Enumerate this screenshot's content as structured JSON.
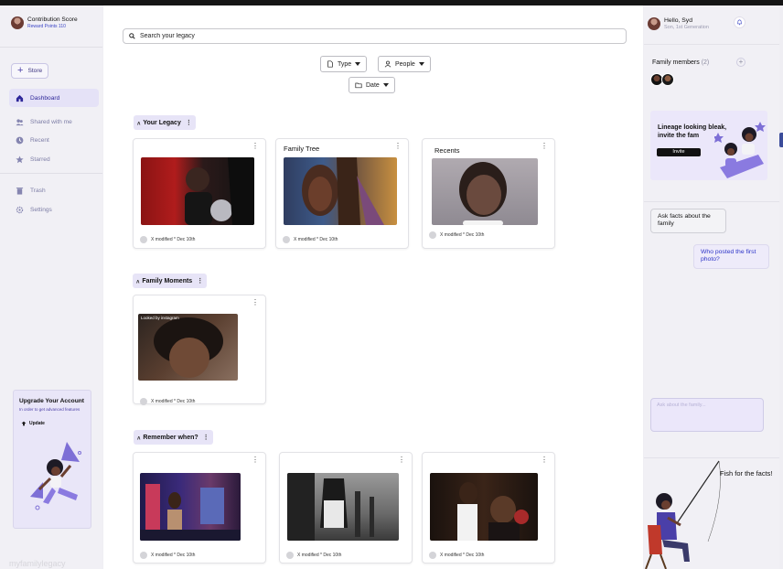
{
  "sidebar": {
    "profile": {
      "title": "Contribution Score",
      "subtitle": "Reward Points 110"
    },
    "store_label": "Store",
    "nav": [
      {
        "label": "Dashboard",
        "icon": "home-icon"
      },
      {
        "label": "Shared with me",
        "icon": "people-icon"
      },
      {
        "label": "Recent",
        "icon": "clock-icon"
      },
      {
        "label": "Starred",
        "icon": "star-icon"
      },
      {
        "label": "Trash",
        "icon": "trash-icon"
      },
      {
        "label": "Settings",
        "icon": "gear-icon"
      }
    ],
    "upgrade": {
      "title": "Upgrade Your Account",
      "subtitle": "In order to get advanced features",
      "button": "Update"
    }
  },
  "main": {
    "search_placeholder": "Search your legacy",
    "filters": {
      "type": "Type",
      "people": "People",
      "date": "Date"
    },
    "sections": [
      {
        "title": "Your Legacy",
        "cards": [
          {
            "title": "",
            "meta": "X modified * Dec 10th"
          },
          {
            "title": "Family Tree",
            "meta": "X modified * Dec 10th"
          },
          {
            "title": "Recents",
            "meta": "X modified * Dec 10th"
          }
        ]
      },
      {
        "title": "Family Moments",
        "cards": [
          {
            "title": "",
            "meta": "X modified * Dec 10th",
            "overlay": "Looked by instagram"
          }
        ]
      },
      {
        "title": "Remember when?",
        "cards": [
          {
            "title": "",
            "meta": "X modified * Dec 10th"
          },
          {
            "title": "",
            "meta": "X modified * Dec 10th"
          },
          {
            "title": "",
            "meta": "X modified * Dec 10th"
          }
        ]
      }
    ]
  },
  "right": {
    "greeting": "Hello, Syd",
    "generation": "Son, 1st Generation",
    "family_members_label": "Family members",
    "family_members_count": "(2)",
    "invite_title": "Lineage looking bleak, invite the fam",
    "invite_button": "Invite",
    "chip_answer": "Ask facts about the family",
    "chip_question": "Who posted the first photo?",
    "ask_placeholder": "Ask about the family...",
    "fish_text": "Fish for the facts!"
  },
  "colors": {
    "accent": "#2d2699",
    "nav_active_bg": "#e5e2f7",
    "panel_bg": "#f1f0f5",
    "purple_card": "#ebe7fa"
  }
}
